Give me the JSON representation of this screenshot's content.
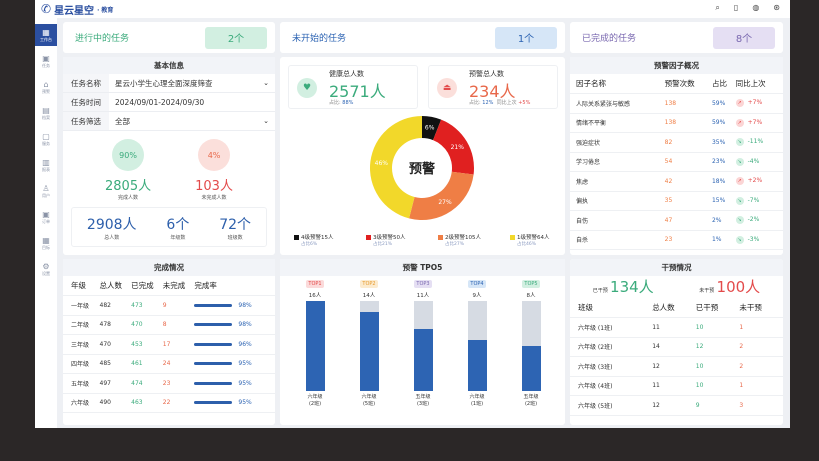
{
  "header": {
    "brand": "星云星空",
    "brand_sub": "· 教育",
    "icons": [
      "search-icon",
      "clipboard-icon",
      "bell-icon",
      "user-icon"
    ]
  },
  "sidebar": [
    {
      "label": "工作台",
      "icon": "▦",
      "active": true
    },
    {
      "label": "任务",
      "icon": "▣"
    },
    {
      "label": "预警",
      "icon": "⌂"
    },
    {
      "label": "档案",
      "icon": "▤"
    },
    {
      "label": "服务",
      "icon": "▢"
    },
    {
      "label": "报表",
      "icon": "▥"
    },
    {
      "label": "用户",
      "icon": "♙"
    },
    {
      "label": "订单",
      "icon": "▣"
    },
    {
      "label": "目标",
      "icon": "▦"
    },
    {
      "label": "设置",
      "icon": "⚙"
    }
  ],
  "summary": [
    {
      "label": "进行中的任务",
      "value": "2个",
      "color": "#3bab7c",
      "bg": "#d2efe1"
    },
    {
      "label": "未开始的任务",
      "value": "1个",
      "color": "#2d64b3",
      "bg": "#d6e6f7"
    },
    {
      "label": "已完成的任务",
      "value": "8个",
      "color": "#7a68b0",
      "bg": "#e5dff3"
    }
  ],
  "basic": {
    "title": "基本信息",
    "name_label": "任务名称",
    "name_value": "星云小学生心理全面深度筛查",
    "time_label": "任务时间",
    "time_value": "2024/09/01-2024/09/30",
    "filter_label": "任务筛选",
    "filter_value": "全部",
    "done_pct": "90%",
    "done_num": "2805人",
    "done_label": "完成人数",
    "undone_pct": "4%",
    "undone_num": "103人",
    "undone_label": "未完成人数",
    "total": "2908人",
    "total_label": "总人数",
    "grades": "6个",
    "grades_label": "年级数",
    "classes": "72个",
    "classes_label": "班级数"
  },
  "health": {
    "title": "健康总人数",
    "value": "2571人",
    "ratio_label": "占比:",
    "ratio": "88%"
  },
  "warning": {
    "title": "预警总人数",
    "value": "234人",
    "ratio_label": "占比:",
    "ratio": "12%",
    "cmp_label": "同比上次",
    "cmp": "+5%"
  },
  "donut": {
    "center": "预警",
    "slices": [
      {
        "label": "4级预警15人",
        "pct": 6,
        "text": "6%",
        "sub": "占比6%",
        "color": "#111111"
      },
      {
        "label": "3级预警50人",
        "pct": 21,
        "text": "21%",
        "sub": "占比21%",
        "color": "#e02020"
      },
      {
        "label": "2级预警105人",
        "pct": 27,
        "text": "27%",
        "sub": "占比27%",
        "color": "#ef7e45"
      },
      {
        "label": "1级预警64人",
        "pct": 46,
        "text": "46%",
        "sub": "占比46%",
        "color": "#f2d82a"
      }
    ]
  },
  "factors": {
    "title": "预警因子概况",
    "headers": [
      "因子名称",
      "预警次数",
      "占比",
      "同比上次"
    ],
    "rows": [
      [
        "人际关系紧张与敏感",
        "138",
        "59%",
        "+7%",
        "up"
      ],
      [
        "情绪不平衡",
        "138",
        "59%",
        "+7%",
        "up"
      ],
      [
        "强迫症状",
        "82",
        "35%",
        "-11%",
        "down"
      ],
      [
        "学习倦怠",
        "54",
        "23%",
        "-4%",
        "down"
      ],
      [
        "焦虑",
        "42",
        "18%",
        "+2%",
        "up"
      ],
      [
        "偏执",
        "35",
        "15%",
        "-7%",
        "down"
      ],
      [
        "自伤",
        "47",
        "2%",
        "-2%",
        "down"
      ],
      [
        "自杀",
        "23",
        "1%",
        "-3%",
        "down"
      ]
    ]
  },
  "completion": {
    "title": "完成情况",
    "headers": [
      "年级",
      "总人数",
      "已完成",
      "未完成",
      "完成率"
    ],
    "rows": [
      [
        "一年级",
        "482",
        "473",
        "9",
        "98%"
      ],
      [
        "二年级",
        "478",
        "470",
        "8",
        "98%"
      ],
      [
        "三年级",
        "470",
        "453",
        "17",
        "96%"
      ],
      [
        "四年级",
        "485",
        "461",
        "24",
        "95%"
      ],
      [
        "五年级",
        "497",
        "474",
        "23",
        "95%"
      ],
      [
        "六年级",
        "490",
        "463",
        "22",
        "95%"
      ]
    ]
  },
  "top5": {
    "title": "预警 TPO5",
    "items": [
      {
        "tag": "TOP1",
        "value": 16,
        "text": "16人",
        "label1": "六年级",
        "label2": "(2班)",
        "tc": "#e34b4b",
        "tb": "#fbdada"
      },
      {
        "tag": "TOP2",
        "value": 14,
        "text": "14人",
        "label1": "六年级",
        "label2": "(5班)",
        "tc": "#e79a2c",
        "tb": "#fcebcf"
      },
      {
        "tag": "TOP3",
        "value": 11,
        "text": "11人",
        "label1": "五年级",
        "label2": "(3班)",
        "tc": "#7a68b0",
        "tb": "#e5dff3"
      },
      {
        "tag": "TOP4",
        "value": 9,
        "text": "9人",
        "label1": "六年级",
        "label2": "(1班)",
        "tc": "#2d64b3",
        "tb": "#d6e6f7"
      },
      {
        "tag": "TOP5",
        "value": 8,
        "text": "8人",
        "label1": "五年级",
        "label2": "(2班)",
        "tc": "#3bab7c",
        "tb": "#d2efe1"
      }
    ],
    "max": 16
  },
  "intervention": {
    "title": "干预情况",
    "done_label": "已干预",
    "done": "134人",
    "undone_label": "未干预",
    "undone": "100人",
    "headers": [
      "班级",
      "总人数",
      "已干预",
      "未干预"
    ],
    "rows": [
      [
        "六年级 (1班)",
        "11",
        "10",
        "1"
      ],
      [
        "六年级 (2班)",
        "14",
        "12",
        "2"
      ],
      [
        "六年级 (3班)",
        "12",
        "10",
        "2"
      ],
      [
        "六年级 (4班)",
        "11",
        "10",
        "1"
      ],
      [
        "六年级 (5班)",
        "12",
        "9",
        "3"
      ]
    ]
  }
}
